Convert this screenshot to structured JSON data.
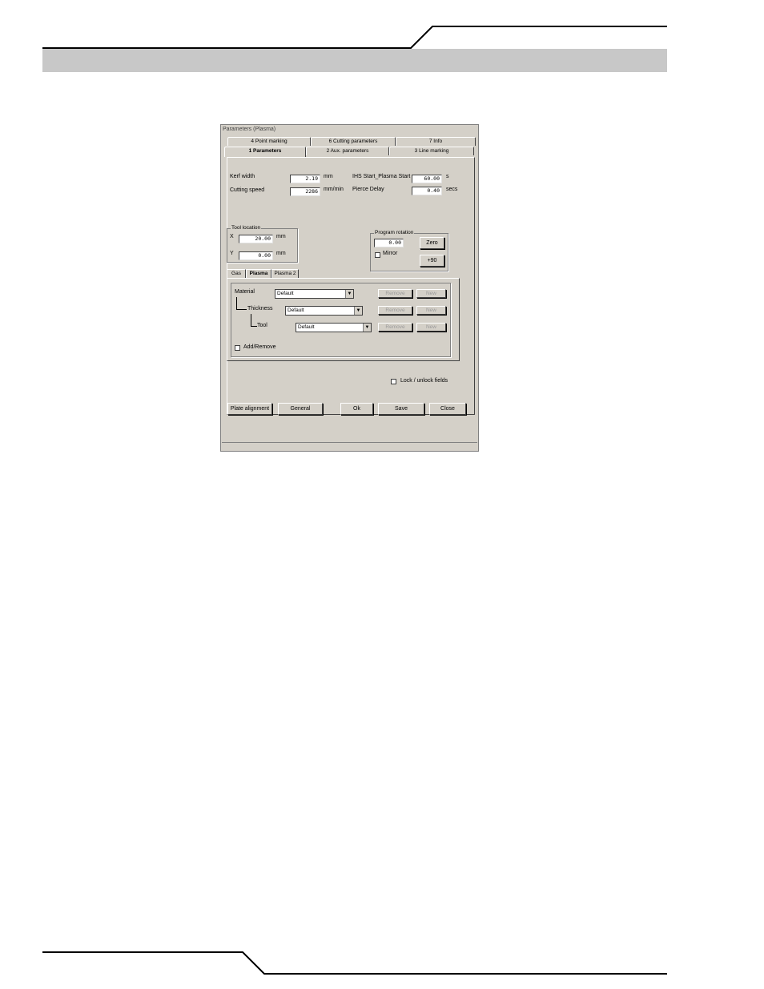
{
  "dialog": {
    "title": "Parameters (Plasma)",
    "tabs_row_back": [
      {
        "label": "4 Point marking"
      },
      {
        "label": "6 Cutting parameters"
      },
      {
        "label": "7 Info"
      }
    ],
    "tabs_row_front": [
      {
        "label": "1 Parameters",
        "active": true
      },
      {
        "label": "2 Aux. parameters"
      },
      {
        "label": "3 Line marking"
      }
    ],
    "kerf": {
      "label": "Kerf width",
      "value": "2.19",
      "unit": "mm"
    },
    "speed": {
      "label": "Cutting speed",
      "value": "2286",
      "unit": "mm/min"
    },
    "ihs": {
      "label": "IHS Start_Plasma Start",
      "value": "60.00",
      "unit": "s"
    },
    "pierce": {
      "label": "Pierce Delay",
      "value": "0.40",
      "unit": "secs"
    },
    "tool_location": {
      "label": "Tool location",
      "x_label": "X",
      "x_value": "20.00",
      "x_unit": "mm",
      "y_label": "Y",
      "y_value": "0.00",
      "y_unit": "mm"
    },
    "program_rotation": {
      "label": "Program rotation",
      "value": "0.00",
      "mirror_label": "Mirror",
      "zero_button": "Zero",
      "plus90_button": "+90"
    },
    "sub_tabs": [
      {
        "label": "Gas"
      },
      {
        "label": "Plasma",
        "active": true
      },
      {
        "label": "Plasma 2"
      }
    ],
    "material": {
      "label": "Material",
      "value": "Default",
      "remove": "Remove",
      "new": "New"
    },
    "thickness": {
      "label": "Thickness",
      "value": "Default",
      "remove": "Remove",
      "new": "New"
    },
    "tool": {
      "label": "Tool",
      "value": "Default",
      "remove": "Remove",
      "new": "New"
    },
    "add_remove_label": "Add/Remove",
    "lock_label": "Lock / unlock fields",
    "buttons": {
      "plate_alignment": "Plate alignment",
      "general": "General",
      "ok": "Ok",
      "save": "Save",
      "close": "Close"
    }
  }
}
